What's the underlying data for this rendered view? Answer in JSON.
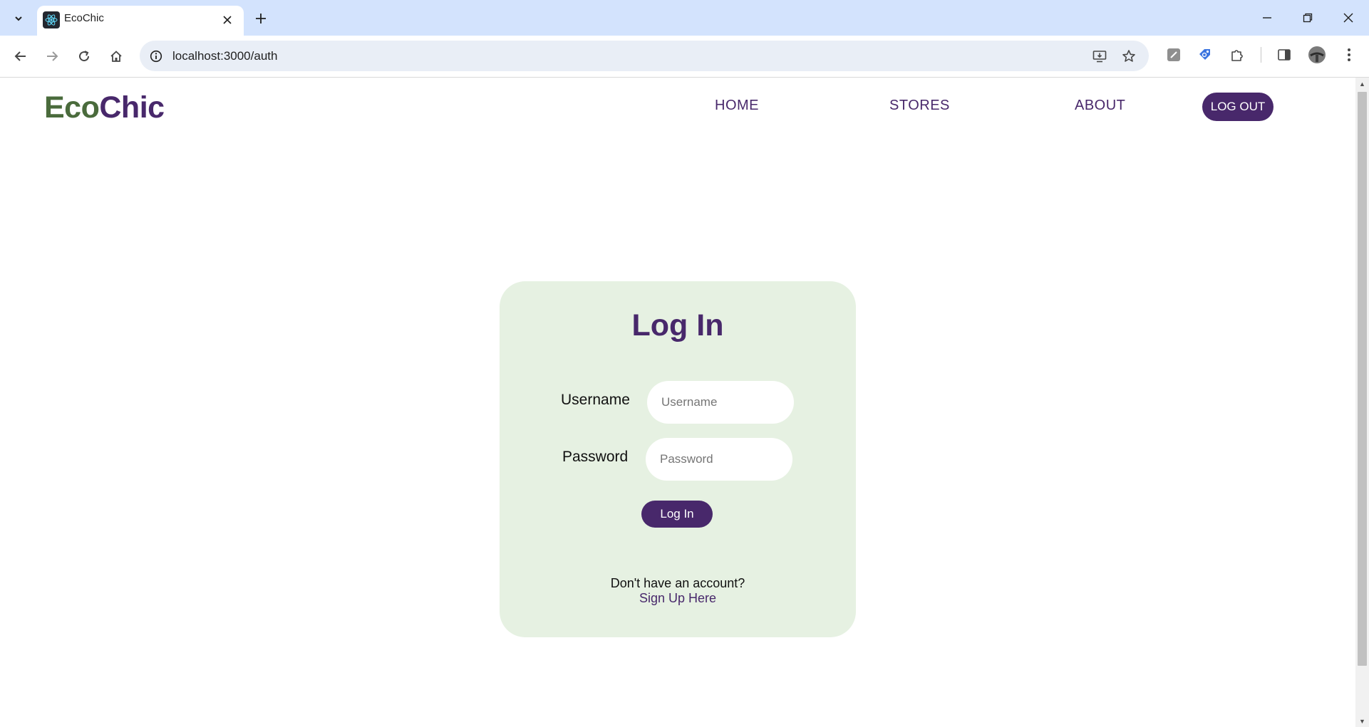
{
  "browser": {
    "tab_title": "EcoChic",
    "url": "localhost:3000/auth"
  },
  "site": {
    "logo_eco": "Eco",
    "logo_chic": "Chic",
    "nav": {
      "home": "HOME",
      "stores": "STORES",
      "about": "ABOUT",
      "logout": "LOG OUT"
    }
  },
  "login": {
    "title": "Log In",
    "username_label": "Username",
    "username_placeholder": "Username",
    "password_label": "Password",
    "password_placeholder": "Password",
    "submit_label": "Log In",
    "signup_prompt": "Don't have an account?",
    "signup_link": "Sign Up Here"
  },
  "colors": {
    "brand_purple": "#48286b",
    "brand_green": "#4a6b3c",
    "card_background": "#e6f1e2"
  }
}
